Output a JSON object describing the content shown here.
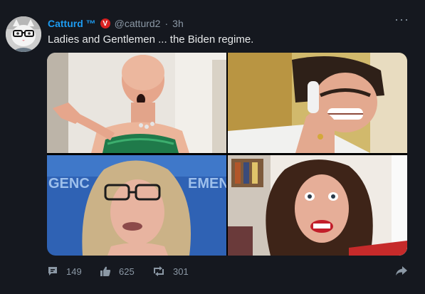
{
  "post": {
    "display_name": "Catturd ™",
    "verified_badge": "V",
    "handle": "@catturd2",
    "separator": "·",
    "time": "3h",
    "text": "Ladies and Gentlemen ... the Biden regime.",
    "more_icon": "more-horizontal-icon"
  },
  "media": {
    "images": [
      {
        "name": "photo-top-left"
      },
      {
        "name": "photo-top-right"
      },
      {
        "name": "photo-bottom-left",
        "sign_text": "GENC EMEN"
      },
      {
        "name": "photo-bottom-right"
      }
    ]
  },
  "actions": {
    "reply_count": "149",
    "like_count": "625",
    "repost_count": "301"
  },
  "colors": {
    "background": "#15181f",
    "accent": "#1d9bf0",
    "muted": "#8b98a5",
    "badge": "#d92121"
  }
}
